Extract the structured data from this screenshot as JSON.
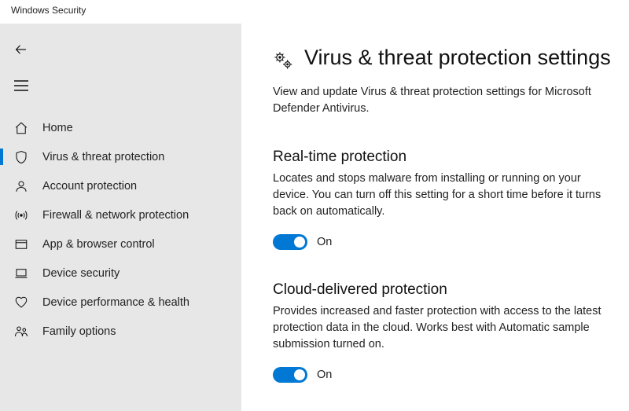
{
  "window": {
    "title": "Windows Security"
  },
  "sidebar": {
    "items": [
      {
        "label": "Home"
      },
      {
        "label": "Virus & threat protection"
      },
      {
        "label": "Account protection"
      },
      {
        "label": "Firewall & network protection"
      },
      {
        "label": "App & browser control"
      },
      {
        "label": "Device security"
      },
      {
        "label": "Device performance & health"
      },
      {
        "label": "Family options"
      }
    ]
  },
  "main": {
    "title": "Virus & threat protection settings",
    "subtitle": "View and update Virus & threat protection settings for Microsoft Defender Antivirus.",
    "sections": [
      {
        "title": "Real-time protection",
        "desc": "Locates and stops malware from installing or running on your device. You can turn off this setting for a short time before it turns back on automatically.",
        "toggle_label": "On"
      },
      {
        "title": "Cloud-delivered protection",
        "desc": "Provides increased and faster protection with access to the latest protection data in the cloud. Works best with Automatic sample submission turned on.",
        "toggle_label": "On"
      }
    ]
  }
}
